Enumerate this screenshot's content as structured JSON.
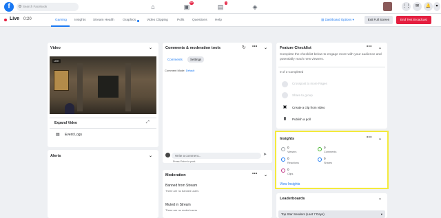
{
  "topbar": {
    "logo": "f",
    "search_placeholder": "Search Facebook",
    "notif_badges": [
      "9+",
      "1"
    ],
    "icons": [
      "home-icon",
      "watch-icon",
      "marketplace-icon",
      "gaming-icon",
      "grid-icon",
      "messenger-icon",
      "bell-icon",
      "caret-icon"
    ]
  },
  "live": {
    "label": "Live",
    "time": "0:20",
    "tabs": [
      "Gaming",
      "Insights",
      "Stream Health",
      "Graphics",
      "Video Clipping",
      "Polls",
      "Questions",
      "Help"
    ],
    "active_tab": "Gaming",
    "dashboard_options": "Dashboard Options",
    "exit_full_screen": "Exit Full Screen",
    "end_broadcast": "End Test Broadcast"
  },
  "video": {
    "title": "Video",
    "live_tag": "LIVE",
    "expand_label": "Expand Video",
    "event_logs": "Event Logs"
  },
  "alerts": {
    "title": "Alerts"
  },
  "comments": {
    "title": "Comments & moderation tools",
    "tabs": [
      "Comments",
      "Settings"
    ],
    "mode_label": "Comment Mode:",
    "mode_value": "Default",
    "input_placeholder": "Write a comment...",
    "hint": "Press Enter to post."
  },
  "moderation": {
    "title": "Moderation",
    "banned_title": "Banned from Stream",
    "banned_sub": "There are no banned users",
    "muted_title": "Muted in Stream",
    "muted_sub": "There are no muted users"
  },
  "feature_checklist": {
    "title": "Feature Checklist",
    "desc": "Complete the checklist below to engage more with your audience and potentially reach new viewers.",
    "progress": "0 of 3 Completed",
    "items": [
      "Crosspost to more Pages",
      "Share to group",
      "Create a clip from video",
      "Publish a poll"
    ]
  },
  "insights": {
    "title": "Insights",
    "metrics": [
      {
        "value": "0",
        "label": "Viewers"
      },
      {
        "value": "0",
        "label": "Comments"
      },
      {
        "value": "0",
        "label": "Reactions"
      },
      {
        "value": "0",
        "label": "Shares"
      },
      {
        "value": "0",
        "label": "Clips"
      }
    ],
    "link": "View Insights"
  },
  "leaderboards": {
    "title": "Leaderboards",
    "select_value": "Top Star Senders (Last 7 Days)"
  },
  "colors": {
    "accent": "#1877f2",
    "live": "#e41e3f",
    "highlight": "#f4ea3c"
  }
}
